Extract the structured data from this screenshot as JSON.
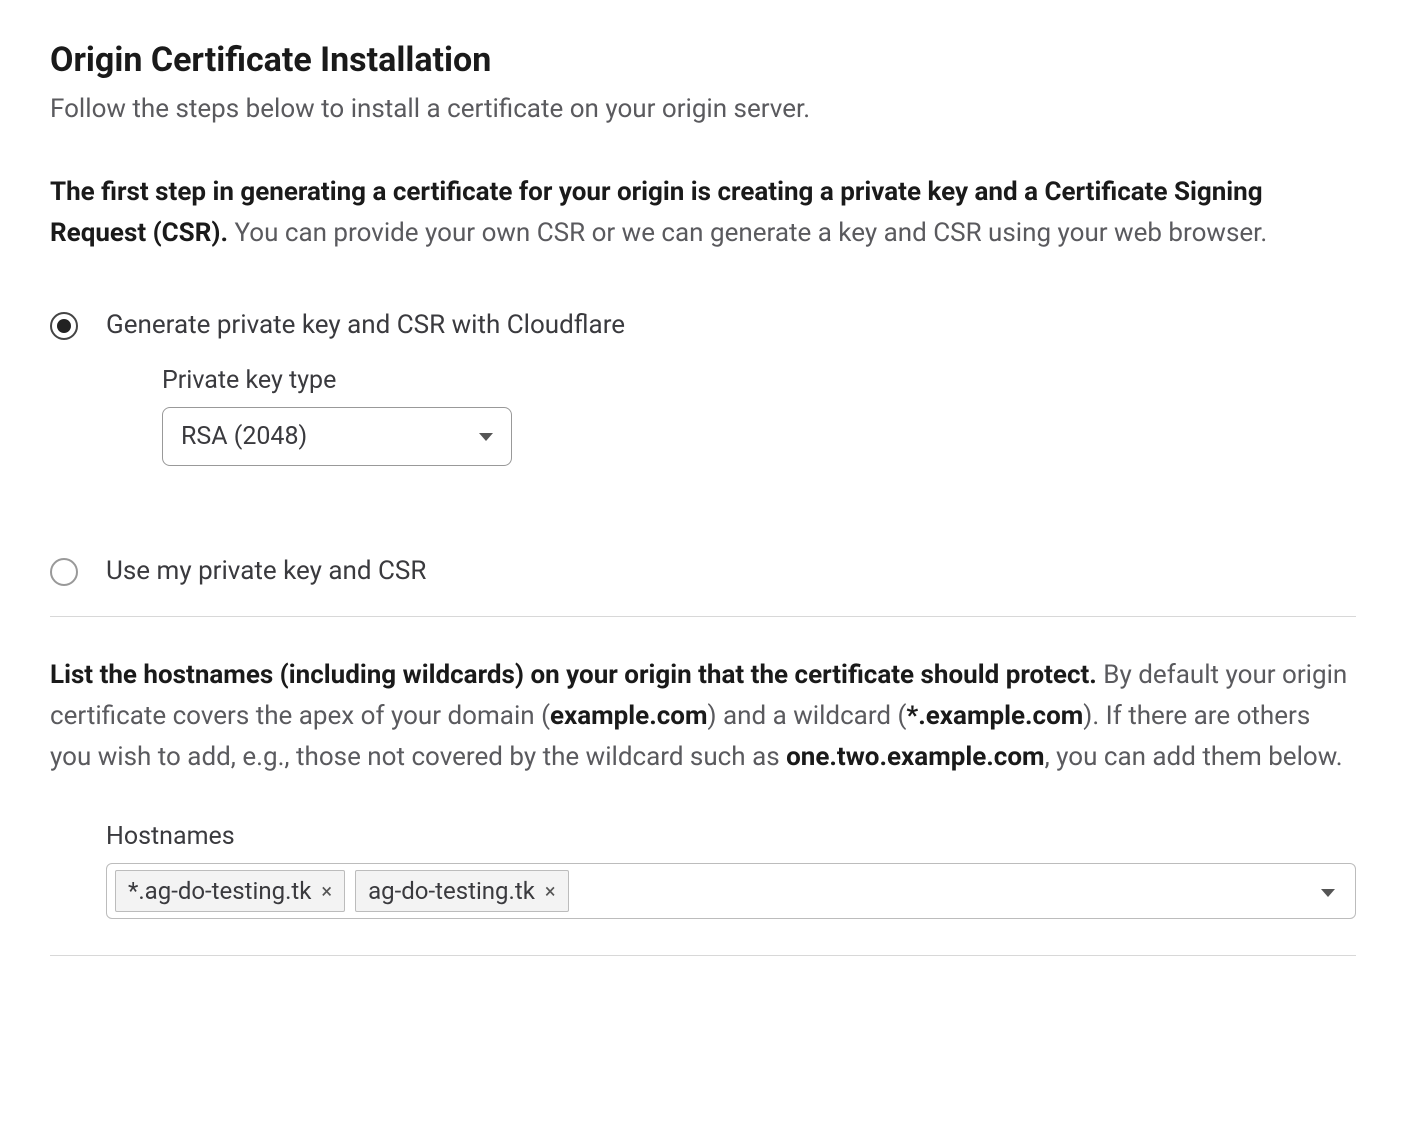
{
  "page": {
    "title": "Origin Certificate Installation",
    "subtitle": "Follow the steps below to install a certificate on your origin server.",
    "intro_bold": "The first step in generating a certificate for your origin is creating a private key and a Certificate Signing Request (CSR).",
    "intro_rest": " You can provide your own CSR or we can generate a key and CSR using your web browser."
  },
  "radio": {
    "option1_label": "Generate private key and CSR with Cloudflare",
    "option2_label": "Use my private key and CSR"
  },
  "private_key": {
    "label": "Private key type",
    "selected": "RSA (2048)"
  },
  "hostnames_intro": {
    "bold1": "List the hostnames (including wildcards) on your origin that the certificate should protect.",
    "part2": " By default your origin certificate covers the apex of your domain (",
    "bold2": "example.com",
    "part3": ") and a wildcard (",
    "bold3": "*.example.com",
    "part4": "). If there are others you wish to add, e.g., those not covered by the wildcard such as ",
    "bold4": "one.two.example.com",
    "part5": ", you can add them below."
  },
  "hostnames": {
    "label": "Hostnames",
    "tags": [
      "*.ag-do-testing.tk",
      "ag-do-testing.tk"
    ]
  }
}
